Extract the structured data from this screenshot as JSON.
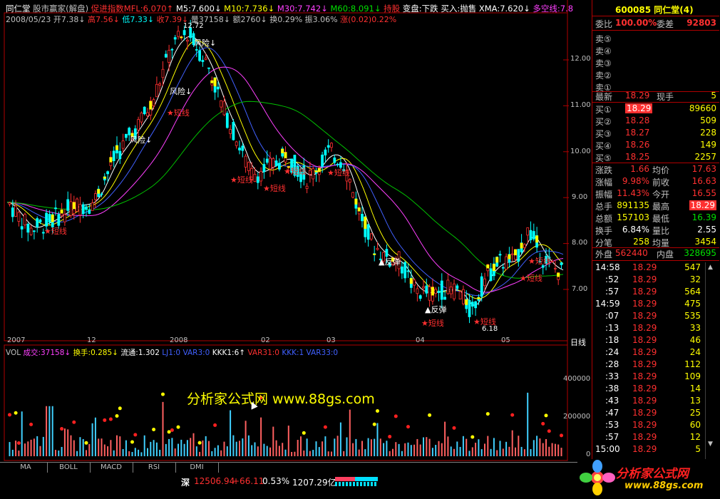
{
  "header": {
    "stock_name": "同仁堂",
    "indicator_title": "股市赢家(解盘)",
    "indicator_label": "促进指数MFL:6.070↑",
    "ma5": "M5:7.600↓",
    "ma10": "M10:7.736↓",
    "ma30": "M30:7.742↓",
    "ma60": "M60:8.091↓",
    "hold": "持股",
    "change_state": "变盘:下跌",
    "buy_sell": "买入:抛售",
    "xma": "XMA:7.620↓",
    "bull_bear": "多空线:7.8"
  },
  "subheader": {
    "date": "2008/05/23",
    "open": "开7.38↓",
    "high": "高7.56↓",
    "low": "低7.33↓",
    "close": "收7.39↓",
    "volume": "量37158↓",
    "amount": "额2760↓",
    "turnover": "换0.29%",
    "amplitude": "振3.06%",
    "change": "涨(0.02)0.22%"
  },
  "chart_annotations": {
    "peak_price": "12.72",
    "low_price": "6.18",
    "risk": "风险↓",
    "risk2": "风险",
    "short_line": "★短线",
    "rebound": "▲反弹",
    "watermark": "分析家公式网 www.88gs.com",
    "daily_label": "日线"
  },
  "price_axis": [
    "12.00",
    "11.00",
    "10.00",
    "9.00",
    "8.00",
    "7.00"
  ],
  "date_axis": [
    "2007",
    "12",
    "2008",
    "02",
    "03",
    "04",
    "05"
  ],
  "vol_header": {
    "vol": "VOL",
    "deal": "成交:37158↓",
    "turn": "换手:0.285↓",
    "circ": "流通:1.302",
    "l1": "LJ1:0",
    "var3": "VAR3:0",
    "kkk1": "KKK1:6↑",
    "var31": "VAR31:0",
    "kkk": "KKK:1",
    "var33": "VAR33:0"
  },
  "vol_axis": [
    "400000",
    "200000",
    "0"
  ],
  "tabs": [
    "MA",
    "BOLL",
    "MACD",
    "RSI",
    "DMI"
  ],
  "quote": {
    "code_name": "600085 同仁堂(4)",
    "weibi_label": "委比",
    "weibi_value": "100.00%",
    "weicha_label": "委差",
    "weicha_value": "92803",
    "sell_levels": [
      "卖⑤",
      "卖④",
      "卖③",
      "卖②",
      "卖①"
    ],
    "last_label": "最新",
    "last_value": "18.29",
    "cur_label": "现手",
    "cur_value": "5",
    "buy_levels": [
      {
        "label": "买①",
        "price": "18.29",
        "vol": "89660"
      },
      {
        "label": "买②",
        "price": "18.28",
        "vol": "509"
      },
      {
        "label": "买③",
        "price": "18.27",
        "vol": "228"
      },
      {
        "label": "买④",
        "price": "18.26",
        "vol": "149"
      },
      {
        "label": "买⑤",
        "price": "18.25",
        "vol": "2257"
      }
    ],
    "stats": [
      {
        "l1": "涨跌",
        "v1": "1.66",
        "l2": "均价",
        "v2": "17.63"
      },
      {
        "l1": "涨幅",
        "v1": "9.98%",
        "l2": "前收",
        "v2": "16.63"
      },
      {
        "l1": "振幅",
        "v1": "11.43%",
        "l2": "今开",
        "v2": "16.55"
      },
      {
        "l1": "总手",
        "v1": "891135",
        "l2": "最高",
        "v2": "18.29"
      },
      {
        "l1": "总额",
        "v1": "157103",
        "l2": "最低",
        "v2": "16.39"
      },
      {
        "l1": "换手",
        "v1": "6.84%",
        "l2": "量比",
        "v2": "2.55"
      },
      {
        "l1": "分笔",
        "v1": "258",
        "l2": "均量",
        "v2": "3454"
      }
    ],
    "outer_label": "外盘",
    "outer_value": "562440",
    "inner_label": "内盘",
    "inner_value": "328695",
    "ticks": [
      {
        "t": "14:58",
        "p": "18.29",
        "v": "547"
      },
      {
        "t": ":52",
        "p": "18.29",
        "v": "32"
      },
      {
        "t": ":57",
        "p": "18.29",
        "v": "564"
      },
      {
        "t": "14:59",
        "p": "18.29",
        "v": "475"
      },
      {
        "t": ":07",
        "p": "18.29",
        "v": "535"
      },
      {
        "t": ":13",
        "p": "18.29",
        "v": "33"
      },
      {
        "t": ":18",
        "p": "18.29",
        "v": "46"
      },
      {
        "t": ":24",
        "p": "18.29",
        "v": "24"
      },
      {
        "t": ":28",
        "p": "18.29",
        "v": "112"
      },
      {
        "t": ":33",
        "p": "18.29",
        "v": "109"
      },
      {
        "t": ":38",
        "p": "18.29",
        "v": "14"
      },
      {
        "t": ":43",
        "p": "18.29",
        "v": "13"
      },
      {
        "t": ":47",
        "p": "18.29",
        "v": "25"
      },
      {
        "t": ":53",
        "p": "18.29",
        "v": "60"
      },
      {
        "t": ":57",
        "p": "18.29",
        "v": "12"
      },
      {
        "t": "15:00",
        "p": "18.29",
        "v": "5"
      }
    ]
  },
  "status": {
    "market": "深",
    "index": "12506.94",
    "delta": "+66.11",
    "pct": "0.53%",
    "amount": "1207.29亿"
  },
  "logo": {
    "text": "分析家公式网",
    "url": "www.88gs.com"
  }
}
